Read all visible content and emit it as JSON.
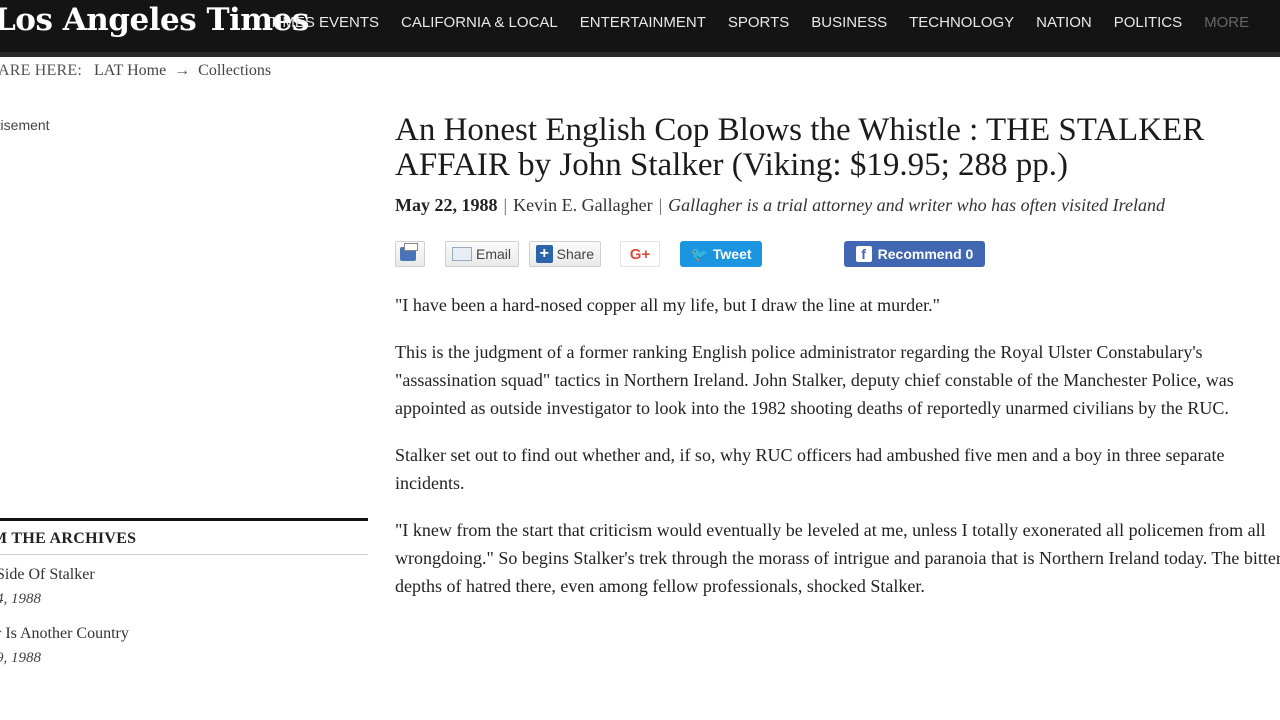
{
  "header": {
    "logo": "Los Angeles Times",
    "nav": [
      "TIMES EVENTS",
      "CALIFORNIA & LOCAL",
      "ENTERTAINMENT",
      "SPORTS",
      "BUSINESS",
      "TECHNOLOGY",
      "NATION",
      "POLITICS",
      "MORE"
    ]
  },
  "breadcrumb": {
    "label": "ARE HERE:",
    "home": "LAT Home",
    "arrow": "→",
    "current": "Collections"
  },
  "sidebar": {
    "advert": "rtisement",
    "archives_title": "M THE ARCHIVES",
    "items": [
      {
        "title": "Side Of Stalker",
        "date": "4, 1988"
      },
      {
        "title": "r Is Another Country",
        "date": "9, 1988"
      }
    ]
  },
  "article": {
    "headline_line1": "An Honest English Cop Blows the Whistle : THE STALKER",
    "headline_line2": "AFFAIR by John Stalker (Viking: $19.95; 288 pp.)",
    "date": "May 22, 1988",
    "author": "Kevin E. Gallagher",
    "author_desc": "Gallagher is a trial attorney and writer who has often visited Ireland",
    "share": {
      "email": "Email",
      "share": "Share",
      "gplus": "G+",
      "tweet": "Tweet",
      "recommend": "Recommend 0"
    },
    "paragraphs": [
      "\"I have been a hard-nosed copper all my life, but I draw the line at murder.\"",
      "This is the judgment of a former ranking English police administrator regarding the Royal Ulster Constabulary's \"assassination squad\" tactics in Northern Ireland. John Stalker, deputy chief constable of the Manchester Police, was appointed as outside investigator to look into the 1982 shooting deaths of reportedly unarmed civilians by the RUC.",
      "Stalker set out to find out whether and, if so, why RUC officers had ambushed five men and a boy in three separate incidents.",
      "\"I knew from the start that criticism would eventually be leveled at me, unless I totally exonerated all policemen from all wrongdoing.\" So begins Stalker's trek through the morass of intrigue and paranoia that is Northern Ireland today. The bitter depths of hatred there, even among fellow professionals, shocked Stalker."
    ]
  }
}
